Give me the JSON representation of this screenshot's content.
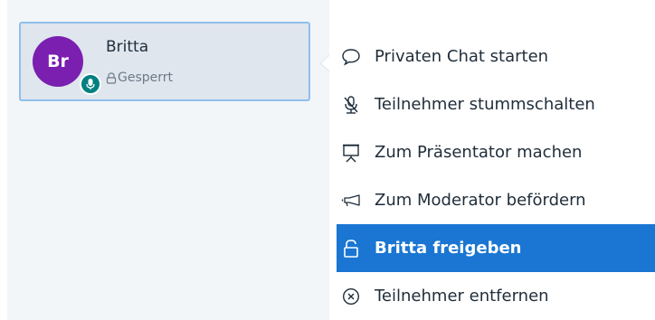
{
  "user": {
    "initials": "Br",
    "name": "Britta",
    "status": "Gesperrt"
  },
  "menu": {
    "items": [
      {
        "label": "Privaten Chat starten",
        "icon": "chat-bubble-icon"
      },
      {
        "label": "Teilnehmer stummschalten",
        "icon": "mic-muted-icon"
      },
      {
        "label": "Zum Präsentator machen",
        "icon": "presentation-board-icon"
      },
      {
        "label": "Zum Moderator befördern",
        "icon": "megaphone-icon"
      },
      {
        "label": "Britta freigeben",
        "icon": "unlock-icon"
      },
      {
        "label": "Teilnehmer entfernen",
        "icon": "circle-x-icon"
      }
    ]
  },
  "colors": {
    "avatar": "#7a1fb0",
    "voice_badge": "#008081",
    "highlight": "#1a76d2",
    "card_border": "#8fc0ea"
  }
}
